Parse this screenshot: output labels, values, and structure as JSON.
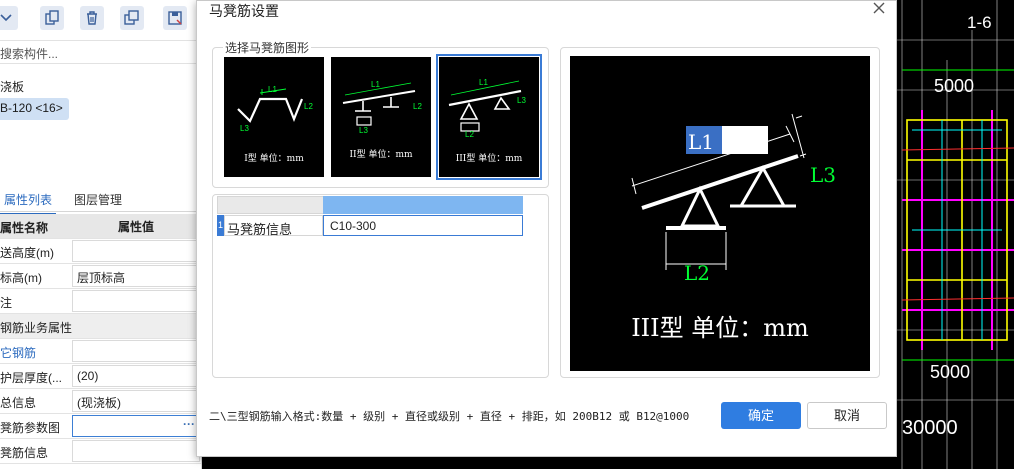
{
  "left_panel": {
    "toolbar_icons": [
      "dropdown-icon",
      "copy-icon",
      "delete-icon",
      "copy-layer-icon",
      "save-icon"
    ],
    "search_placeholder": "搜索构件...",
    "tree_root": "浇板",
    "tree_node": "B-120 <16>",
    "tabs": {
      "attrs": "属性列表",
      "layers": "图层管理"
    },
    "table_header": {
      "name": "属性名称",
      "value": "属性值"
    },
    "rows": [
      {
        "name": "送高度(m)",
        "value": ""
      },
      {
        "name": "标高(m)",
        "value": "层顶标高"
      },
      {
        "name": "注",
        "value": ""
      },
      {
        "name": "钢筋业务属性",
        "value": ""
      },
      {
        "name": "它钢筋",
        "value": ""
      },
      {
        "name": "护层厚度(...",
        "value": "(20)"
      },
      {
        "name": "总信息",
        "value": "(现浇板)"
      },
      {
        "name": "凳筋参数图",
        "value": ""
      },
      {
        "name": "凳筋信息",
        "value": ""
      }
    ],
    "dots": "···"
  },
  "dialog": {
    "title": "马凳筋设置",
    "group_label": "选择马凳筋图形",
    "thumbs": [
      {
        "caption": "I型 单位：mm",
        "selected": false
      },
      {
        "caption": "II型 单位：mm",
        "selected": false
      },
      {
        "caption": "III型 单位：mm",
        "selected": true
      }
    ],
    "thumb_labels": {
      "l1": "L1",
      "l2": "L2",
      "l3": "L3"
    },
    "grid": {
      "row_number": "1",
      "name": "马凳筋信息",
      "value": "C10-300"
    },
    "preview": {
      "l1": "L1",
      "l2": "L2",
      "l3": "L3",
      "caption": "III型 单位：mm"
    },
    "hint": "二\\三型钢筋输入格式:数量 + 级别 + 直径或级别 + 直径 + 排距，如 200B12 或 B12@1000",
    "ok_label": "确定",
    "cancel_label": "取消"
  },
  "cad": {
    "labels": [
      "1-6",
      "5000",
      "5000",
      "30000"
    ],
    "colors": {
      "yellow": "#ffff00",
      "magenta": "#ff00ff",
      "cyan": "#00ffff",
      "green": "#00ff00",
      "white": "#ffffff",
      "red": "#ff3030"
    }
  },
  "colors": {
    "accent": "#2f7de1",
    "selected_row": "#cfe0f4",
    "dim_green": "#00ff33",
    "label_box": "#ffffff"
  }
}
